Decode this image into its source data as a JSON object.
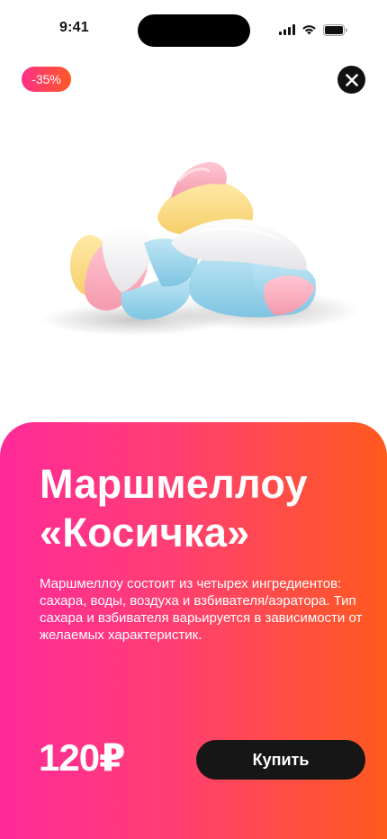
{
  "status_bar": {
    "time": "9:41"
  },
  "badge": {
    "discount": "-35%"
  },
  "icons": {
    "close": "close-icon",
    "signal": "cellular-signal-icon",
    "wifi": "wifi-icon",
    "battery": "battery-icon"
  },
  "product": {
    "title_line1": "Маршмеллоу",
    "title_line2": "«Косичка»",
    "description": "Маршмеллоу состоит из четырех ингредиентов: сахара, воды, воздуха и взбивателя/аэратора. Тип сахара и взбивателя варьируется в зависимости от желаемых характеристик.",
    "price": "120₽",
    "buy_label": "Купить"
  },
  "colors": {
    "gradient_start": "#ff2a9a",
    "gradient_end": "#ff5a1e",
    "button_bg": "#161616"
  }
}
